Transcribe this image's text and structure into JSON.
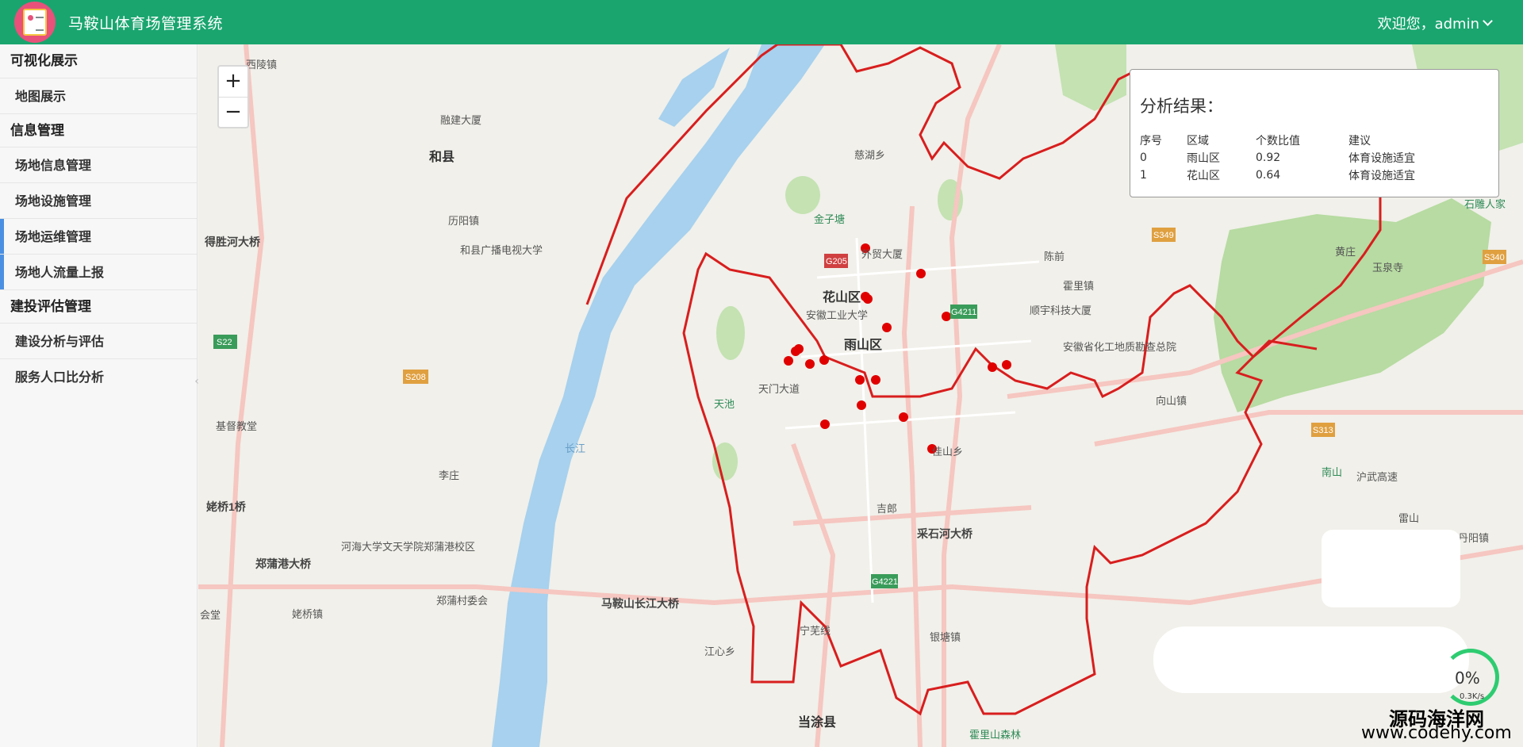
{
  "header": {
    "app_title": "马鞍山体育场管理系统",
    "welcome": "欢迎您，admin"
  },
  "sidebar": {
    "groups": [
      {
        "title": "可视化展示",
        "items": [
          "地图展示"
        ]
      },
      {
        "title": "信息管理",
        "items": [
          "场地信息管理",
          "场地设施管理",
          "场地运维管理",
          "场地人流量上报"
        ]
      },
      {
        "title": "建投评估管理",
        "items": [
          "建设分析与评估",
          "服务人口比分析"
        ]
      }
    ]
  },
  "map": {
    "zoom_in": "+",
    "zoom_out": "−",
    "labels": [
      "西陵镇",
      "融建大厦",
      "和县",
      "慈湖乡",
      "历阳镇",
      "和县广播电视大学",
      "得胜河大桥",
      "金子塘",
      "外贸大厦",
      "陈前",
      "霍里镇",
      "花山区",
      "安徽工业大学",
      "顺宇科技大厦",
      "雨山区",
      "安徽省化工地质勘查总院",
      "天池",
      "天门大道",
      "向山镇",
      "基督教堂",
      "李庄",
      "佳山乡",
      "姥桥1桥",
      "吉郎",
      "采石河大桥",
      "河海大学文天学院郑蒲港校区",
      "郑蒲港大桥",
      "郑蒲村委会",
      "马鞍山长江大桥",
      "会堂",
      "姥桥镇",
      "江心乡",
      "银塘镇",
      "当涂县",
      "黄庄",
      "玉泉寺",
      "石雕人家",
      "南山",
      "沪武高速",
      "雷山",
      "丹阳镇",
      "长江",
      "宁芜线",
      "霍里山森林"
    ],
    "road_badges": [
      "S22",
      "S208",
      "G205",
      "G4211",
      "S349",
      "S340",
      "S313",
      "G4221"
    ],
    "point_color": "#e00000",
    "boundary_color": "#d81e1e"
  },
  "analysis": {
    "title": "分析结果：",
    "columns": [
      "序号",
      "区域",
      "个数比值",
      "建议"
    ],
    "rows": [
      [
        "0",
        "雨山区",
        "0.92",
        "体育设施适宜"
      ],
      [
        "1",
        "花山区",
        "0.64",
        "体育设施适宜"
      ]
    ]
  },
  "overlay": {
    "net_pct": "0%",
    "net_speed": "0.3K/s",
    "watermark_cn": "源码海洋网",
    "watermark_url": "www.codehy.com"
  }
}
